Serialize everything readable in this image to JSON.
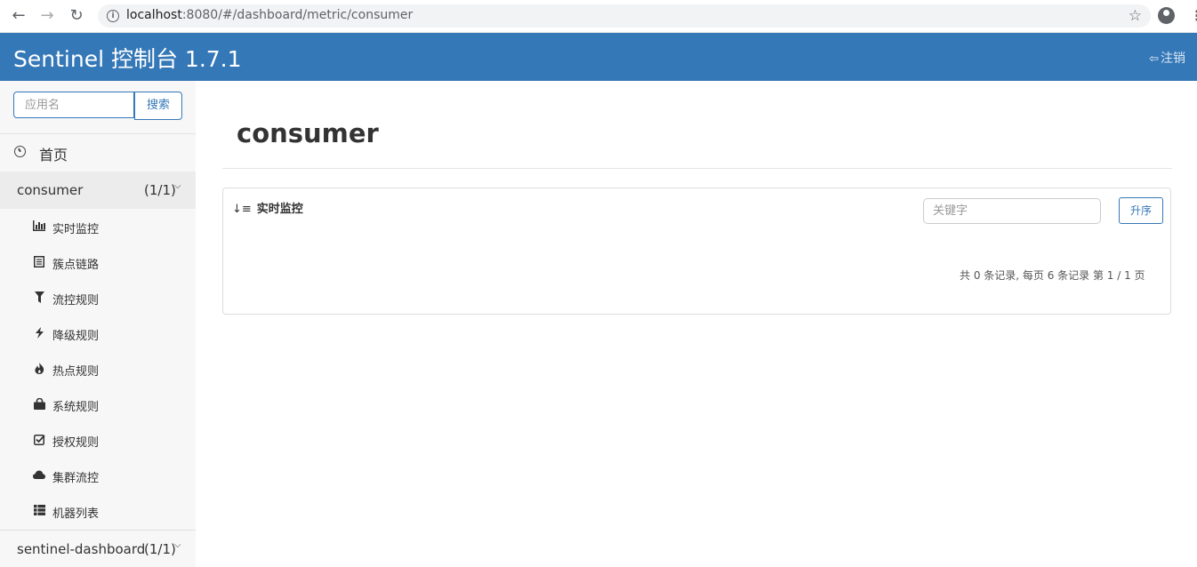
{
  "browser": {
    "back_icon": "←",
    "forward_icon": "→",
    "reload_icon": "↻",
    "info_icon": "i",
    "url_host": "localhost",
    "url_rest": ":8080/#/dashboard/metric/consumer",
    "star_icon": "☆",
    "menu_icon": "⋮"
  },
  "header": {
    "title": "Sentinel 控制台 1.7.1",
    "logout_label": "注销",
    "logout_icon": "⇦",
    "bg_color": "#3578b7"
  },
  "sidebar": {
    "search_placeholder": "应用名",
    "search_button": "搜索",
    "home_label": "首页",
    "app": {
      "name": "consumer",
      "count": "(1/1)",
      "chevron": "⌵"
    },
    "items": [
      {
        "label": "实时监控",
        "icon": "bar-chart-icon",
        "glyph": "📊"
      },
      {
        "label": "簇点链路",
        "icon": "list-icon",
        "glyph": "▤"
      },
      {
        "label": "流控规则",
        "icon": "filter-icon",
        "glyph": "▼"
      },
      {
        "label": "降级规则",
        "icon": "flash-icon",
        "glyph": "⚡"
      },
      {
        "label": "热点规则",
        "icon": "fire-icon",
        "glyph": "🔥"
      },
      {
        "label": "系统规则",
        "icon": "lock-icon",
        "glyph": "🔒"
      },
      {
        "label": "授权规则",
        "icon": "check-icon",
        "glyph": "☑"
      },
      {
        "label": "集群流控",
        "icon": "cloud-icon",
        "glyph": "☁"
      },
      {
        "label": "机器列表",
        "icon": "th-list-icon",
        "glyph": "▦"
      }
    ],
    "app2": {
      "name": "sentinel-dashboard",
      "count": "(1/1)",
      "chevron": "⌵"
    }
  },
  "main": {
    "title": "consumer",
    "panel": {
      "heading": "实时监控",
      "sort_icon": "↓≡",
      "keyword_placeholder": "关键字",
      "asc_button": "升序",
      "pager": "共 0 条记录, 每页 6 条记录 第 1 / 1 页"
    }
  }
}
